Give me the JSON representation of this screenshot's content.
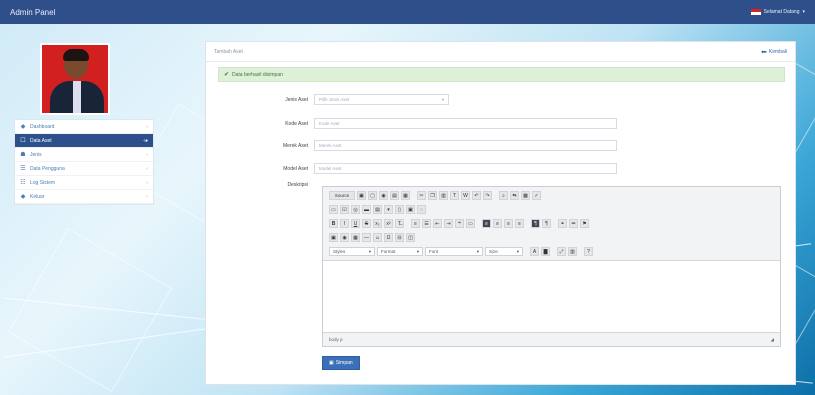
{
  "app": {
    "title": "Admin Panel"
  },
  "user_menu": {
    "label": "Selamat Datang",
    "caret": "▾"
  },
  "sidebar": {
    "items": [
      {
        "icon": "home-icon",
        "glyph": "◆",
        "label": "Dashboard",
        "chevron": "‹",
        "active": false
      },
      {
        "icon": "asset-icon",
        "glyph": "☐",
        "label": "Data Aset",
        "chevron": "‹●",
        "active": true
      },
      {
        "icon": "users-icon",
        "glyph": "☗",
        "label": "Jenis",
        "chevron": "‹",
        "active": false
      },
      {
        "icon": "group-icon",
        "glyph": "☰",
        "label": "Data Pengguna",
        "chevron": "‹",
        "active": false
      },
      {
        "icon": "log-icon",
        "glyph": "☷",
        "label": "Log Sistem",
        "chevron": "‹",
        "active": false
      },
      {
        "icon": "logout-icon",
        "glyph": "◆",
        "label": "Keluar",
        "chevron": "‹",
        "active": false
      }
    ]
  },
  "panel": {
    "title": "Tambah Aset",
    "back_label": "Kembali",
    "alert": "Data berhasil disimpan"
  },
  "form": {
    "jenis": {
      "label": "Jenis Aset",
      "value": "Pilih Jenis Aset"
    },
    "kode": {
      "label": "Kode Aset",
      "placeholder": "Kode Aset"
    },
    "merek": {
      "label": "Merek Aset",
      "placeholder": "Merek Aset"
    },
    "model": {
      "label": "Model Aset",
      "placeholder": "Model Aset"
    },
    "deskripsi": {
      "label": "Deskripsi"
    }
  },
  "editor": {
    "source_label": "Source",
    "styles_label": "Styles",
    "format_label": "Format",
    "font_label": "Font",
    "size_label": "Size",
    "status_path": "body p",
    "resize": "◢"
  },
  "submit": {
    "label": "Simpan"
  }
}
